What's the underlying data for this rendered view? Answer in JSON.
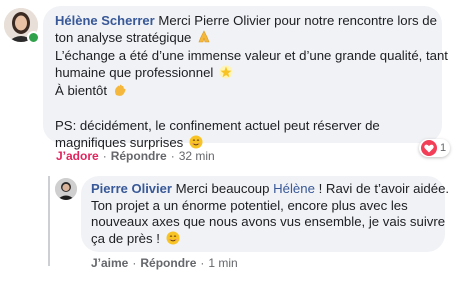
{
  "comment": {
    "author": "Hélène Scherrer",
    "first_line_rest": "Merci Pierre Olivier pour notre rencontre lors de",
    "lines": [
      "ton analyse stratégique",
      "L’échange a été d’une immense valeur et d’une grande qualité, tant",
      "humaine que professionnel",
      "À bientôt",
      "",
      "PS: décidément, le confinement actuel peut réserver de",
      "magnifiques surprises"
    ],
    "emojis": [
      "folded-hands",
      "glowing-star",
      "waving-hand",
      "smiling-face"
    ],
    "actions": {
      "react": "J’adore",
      "reply": "Répondre",
      "time": "32 min"
    },
    "reaction_count": "1"
  },
  "reply": {
    "author": "Pierre Olivier",
    "first_line_rest_a": "Merci beaucoup",
    "mention": "Hélène",
    "first_line_rest_b": "! Ravi de t’avoir aidée.",
    "lines": [
      "Ton projet a un énorme potentiel, encore plus avec les",
      "nouveaux axes que nous avons vus ensemble, je vais suivre",
      "ça de près !"
    ],
    "actions": {
      "react": "J’aime",
      "reply": "Répondre",
      "time": "1 min"
    }
  },
  "colors": {
    "link": "#385898",
    "love": "#e0245e",
    "bubble": "#f0f2f5",
    "online": "#31a24c"
  }
}
